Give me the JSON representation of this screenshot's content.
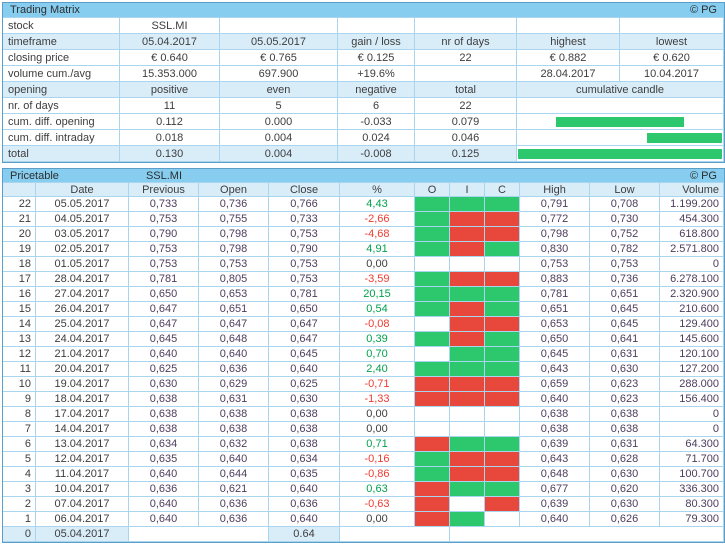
{
  "colors": {
    "title_bar": "#86cdf0",
    "cell_blue": "#d9edf9",
    "border_light": "#aad5ef",
    "border_outer": "#5d9ec9",
    "green": "#2dc76d",
    "red": "#e8483c",
    "pct_green": "#00a14e",
    "pct_red": "#ee3c31",
    "text_dark": "#3d3d3d",
    "text_price": "#4d3c5c"
  },
  "matrix": {
    "title": "Trading Matrix",
    "copyright": "© PG",
    "rows": [
      {
        "bg": "white",
        "cells": [
          {
            "t": "stock",
            "label": 1,
            "name": "matrix-row-label"
          },
          {
            "t": "SSL.MI",
            "name": "stock-symbol-cell"
          },
          {
            "t": ""
          },
          {
            "t": ""
          },
          {
            "t": ""
          },
          {
            "t": ""
          },
          {
            "t": ""
          }
        ]
      },
      {
        "bg": "blue",
        "cells": [
          {
            "t": "timeframe",
            "label": 1,
            "name": "matrix-row-label"
          },
          {
            "t": "05.04.2017",
            "name": "timeframe-start-cell"
          },
          {
            "t": "05.05.2017",
            "name": "timeframe-end-cell"
          },
          {
            "t": "gain / loss",
            "name": "gain-loss-header"
          },
          {
            "t": "nr of days",
            "name": "nr-of-days-header"
          },
          {
            "t": "highest",
            "name": "highest-header"
          },
          {
            "t": "lowest",
            "name": "lowest-header"
          }
        ]
      },
      {
        "bg": "white",
        "cells": [
          {
            "t": "closing price",
            "label": 1,
            "name": "matrix-row-label"
          },
          {
            "t": "€ 0.640"
          },
          {
            "t": "€ 0.765"
          },
          {
            "t": "€ 0.125"
          },
          {
            "t": "22"
          },
          {
            "t": "€ 0.882"
          },
          {
            "t": "€ 0.620"
          }
        ]
      },
      {
        "bg": "white",
        "cells": [
          {
            "t": "volume cum./avg",
            "label": 1,
            "name": "matrix-row-label"
          },
          {
            "t": "15.353.000"
          },
          {
            "t": "697.900"
          },
          {
            "t": "+19.6%"
          },
          {
            "t": ""
          },
          {
            "t": "28.04.2017"
          },
          {
            "t": "10.04.2017"
          }
        ]
      },
      {
        "bg": "blue",
        "cells": [
          {
            "t": "opening",
            "label": 1,
            "name": "matrix-row-label"
          },
          {
            "t": "positive",
            "name": "positive-header"
          },
          {
            "t": "even",
            "name": "even-header"
          },
          {
            "t": "negative",
            "name": "negative-header"
          },
          {
            "t": "total",
            "name": "total-header"
          },
          {
            "t": "cumulative candle",
            "span": 2,
            "name": "cumulative-candle-header"
          }
        ]
      },
      {
        "bg": "white",
        "cells": [
          {
            "t": "nr. of days",
            "label": 1,
            "name": "matrix-row-label"
          },
          {
            "t": "11"
          },
          {
            "t": "5"
          },
          {
            "t": "6"
          },
          {
            "t": "22"
          },
          {
            "t": "",
            "span": 2
          }
        ]
      },
      {
        "bg": "white",
        "cells": [
          {
            "t": "cum. diff. opening",
            "label": 1,
            "name": "matrix-row-label"
          },
          {
            "t": "0.112"
          },
          {
            "t": "0.000"
          },
          {
            "t": "-0.033"
          },
          {
            "t": "0.079"
          },
          {
            "span": 2,
            "bar": {
              "anchor": "left",
              "pct": 63.2
            },
            "name": "cumulative-candle-bar-cell"
          }
        ]
      },
      {
        "bg": "white",
        "cells": [
          {
            "t": "cum. diff. intraday",
            "label": 1,
            "name": "matrix-row-label"
          },
          {
            "t": "0.018"
          },
          {
            "t": "0.004"
          },
          {
            "t": "0.024"
          },
          {
            "t": "0.046"
          },
          {
            "span": 2,
            "bar": {
              "anchor": "right",
              "pct": 36.8
            },
            "name": "cumulative-candle-bar-cell"
          }
        ]
      },
      {
        "bg": "blue",
        "cells": [
          {
            "t": "total",
            "label": 1,
            "name": "matrix-row-label"
          },
          {
            "t": "0.130"
          },
          {
            "t": "0.004"
          },
          {
            "t": "-0.008"
          },
          {
            "t": "0.125"
          },
          {
            "span": 2,
            "bar": {
              "anchor": "left",
              "pct": 100
            },
            "name": "cumulative-candle-bar-cell"
          }
        ]
      }
    ]
  },
  "pricetable": {
    "title": "Pricetable",
    "symbol": "SSL.MI",
    "copyright": "© PG",
    "headers": [
      "",
      "Date",
      "Previous",
      "Open",
      "Close",
      "%",
      "O",
      "I",
      "C",
      "High",
      "Low",
      "Volume"
    ],
    "rows": [
      {
        "n": "22",
        "date": "05.05.2017",
        "previous": "0,733",
        "open": "0,736",
        "close": "0,766",
        "pct": "4,43",
        "pct_color": "green",
        "o": "green",
        "i": "green",
        "c": "green",
        "high": "0,791",
        "low": "0,708",
        "volume": "1.199.200"
      },
      {
        "n": "21",
        "date": "04.05.2017",
        "previous": "0,753",
        "open": "0,755",
        "close": "0,733",
        "pct": "-2,66",
        "pct_color": "red",
        "o": "green",
        "i": "red",
        "c": "red",
        "high": "0,772",
        "low": "0,730",
        "volume": "454.300"
      },
      {
        "n": "20",
        "date": "03.05.2017",
        "previous": "0,790",
        "open": "0,798",
        "close": "0,753",
        "pct": "-4,68",
        "pct_color": "red",
        "o": "green",
        "i": "red",
        "c": "red",
        "high": "0,798",
        "low": "0,752",
        "volume": "618.800"
      },
      {
        "n": "19",
        "date": "02.05.2017",
        "previous": "0,753",
        "open": "0,798",
        "close": "0,790",
        "pct": "4,91",
        "pct_color": "green",
        "o": "green",
        "i": "red",
        "c": "green",
        "high": "0,830",
        "low": "0,782",
        "volume": "2.571.800"
      },
      {
        "n": "18",
        "date": "01.05.2017",
        "previous": "0,753",
        "open": "0,753",
        "close": "0,753",
        "pct": "0,00",
        "pct_color": "black",
        "o": "white",
        "i": "white",
        "c": "white",
        "high": "0,753",
        "low": "0,753",
        "volume": "0"
      },
      {
        "n": "17",
        "date": "28.04.2017",
        "previous": "0,781",
        "open": "0,805",
        "close": "0,753",
        "pct": "-3,59",
        "pct_color": "red",
        "o": "green",
        "i": "red",
        "c": "red",
        "high": "0,883",
        "low": "0,736",
        "volume": "6.278.100"
      },
      {
        "n": "16",
        "date": "27.04.2017",
        "previous": "0,650",
        "open": "0,653",
        "close": "0,781",
        "pct": "20,15",
        "pct_color": "green",
        "o": "green",
        "i": "green",
        "c": "green",
        "high": "0,781",
        "low": "0,651",
        "volume": "2.320.900"
      },
      {
        "n": "15",
        "date": "26.04.2017",
        "previous": "0,647",
        "open": "0,651",
        "close": "0,650",
        "pct": "0,54",
        "pct_color": "green",
        "o": "green",
        "i": "red",
        "c": "green",
        "high": "0,651",
        "low": "0,645",
        "volume": "210.600"
      },
      {
        "n": "14",
        "date": "25.04.2017",
        "previous": "0,647",
        "open": "0,647",
        "close": "0,647",
        "pct": "-0,08",
        "pct_color": "red",
        "o": "white",
        "i": "red",
        "c": "red",
        "high": "0,653",
        "low": "0,645",
        "volume": "129.400"
      },
      {
        "n": "13",
        "date": "24.04.2017",
        "previous": "0,645",
        "open": "0,648",
        "close": "0,647",
        "pct": "0,39",
        "pct_color": "green",
        "o": "green",
        "i": "red",
        "c": "green",
        "high": "0,650",
        "low": "0,641",
        "volume": "145.600"
      },
      {
        "n": "12",
        "date": "21.04.2017",
        "previous": "0,640",
        "open": "0,640",
        "close": "0,645",
        "pct": "0,70",
        "pct_color": "green",
        "o": "white",
        "i": "green",
        "c": "green",
        "high": "0,645",
        "low": "0,631",
        "volume": "120.100"
      },
      {
        "n": "11",
        "date": "20.04.2017",
        "previous": "0,625",
        "open": "0,636",
        "close": "0,640",
        "pct": "2,40",
        "pct_color": "green",
        "o": "green",
        "i": "green",
        "c": "green",
        "high": "0,643",
        "low": "0,630",
        "volume": "127.200"
      },
      {
        "n": "10",
        "date": "19.04.2017",
        "previous": "0,630",
        "open": "0,629",
        "close": "0,625",
        "pct": "-0,71",
        "pct_color": "red",
        "o": "red",
        "i": "red",
        "c": "red",
        "high": "0,659",
        "low": "0,623",
        "volume": "288.000"
      },
      {
        "n": "9",
        "date": "18.04.2017",
        "previous": "0,638",
        "open": "0,631",
        "close": "0,630",
        "pct": "-1,33",
        "pct_color": "red",
        "o": "red",
        "i": "red",
        "c": "red",
        "high": "0,640",
        "low": "0,623",
        "volume": "156.400"
      },
      {
        "n": "8",
        "date": "17.04.2017",
        "previous": "0,638",
        "open": "0,638",
        "close": "0,638",
        "pct": "0,00",
        "pct_color": "black",
        "o": "white",
        "i": "white",
        "c": "white",
        "high": "0,638",
        "low": "0,638",
        "volume": "0"
      },
      {
        "n": "7",
        "date": "14.04.2017",
        "previous": "0,638",
        "open": "0,638",
        "close": "0,638",
        "pct": "0,00",
        "pct_color": "black",
        "o": "white",
        "i": "white",
        "c": "white",
        "high": "0,638",
        "low": "0,638",
        "volume": "0"
      },
      {
        "n": "6",
        "date": "13.04.2017",
        "previous": "0,634",
        "open": "0,632",
        "close": "0,638",
        "pct": "0,71",
        "pct_color": "green",
        "o": "red",
        "i": "green",
        "c": "green",
        "high": "0,639",
        "low": "0,631",
        "volume": "64.300"
      },
      {
        "n": "5",
        "date": "12.04.2017",
        "previous": "0,635",
        "open": "0,640",
        "close": "0,634",
        "pct": "-0,16",
        "pct_color": "red",
        "o": "green",
        "i": "red",
        "c": "red",
        "high": "0,643",
        "low": "0,628",
        "volume": "71.700"
      },
      {
        "n": "4",
        "date": "11.04.2017",
        "previous": "0,640",
        "open": "0,644",
        "close": "0,635",
        "pct": "-0,86",
        "pct_color": "red",
        "o": "green",
        "i": "red",
        "c": "red",
        "high": "0,648",
        "low": "0,630",
        "volume": "100.700"
      },
      {
        "n": "3",
        "date": "10.04.2017",
        "previous": "0,636",
        "open": "0,621",
        "close": "0,640",
        "pct": "0,63",
        "pct_color": "green",
        "o": "red",
        "i": "green",
        "c": "green",
        "high": "0,677",
        "low": "0,620",
        "volume": "336.300"
      },
      {
        "n": "2",
        "date": "07.04.2017",
        "previous": "0,640",
        "open": "0,636",
        "close": "0,636",
        "pct": "-0,63",
        "pct_color": "red",
        "o": "red",
        "i": "white",
        "c": "red",
        "high": "0,639",
        "low": "0,630",
        "volume": "80.300"
      },
      {
        "n": "1",
        "date": "06.04.2017",
        "previous": "0,640",
        "open": "0,636",
        "close": "0,640",
        "pct": "0,00",
        "pct_color": "black",
        "o": "red",
        "i": "green",
        "c": "white",
        "high": "0,640",
        "low": "0,626",
        "volume": "79.300"
      }
    ],
    "footer_row": {
      "n": "0",
      "date": "05.04.2017",
      "close": "0.64"
    }
  }
}
